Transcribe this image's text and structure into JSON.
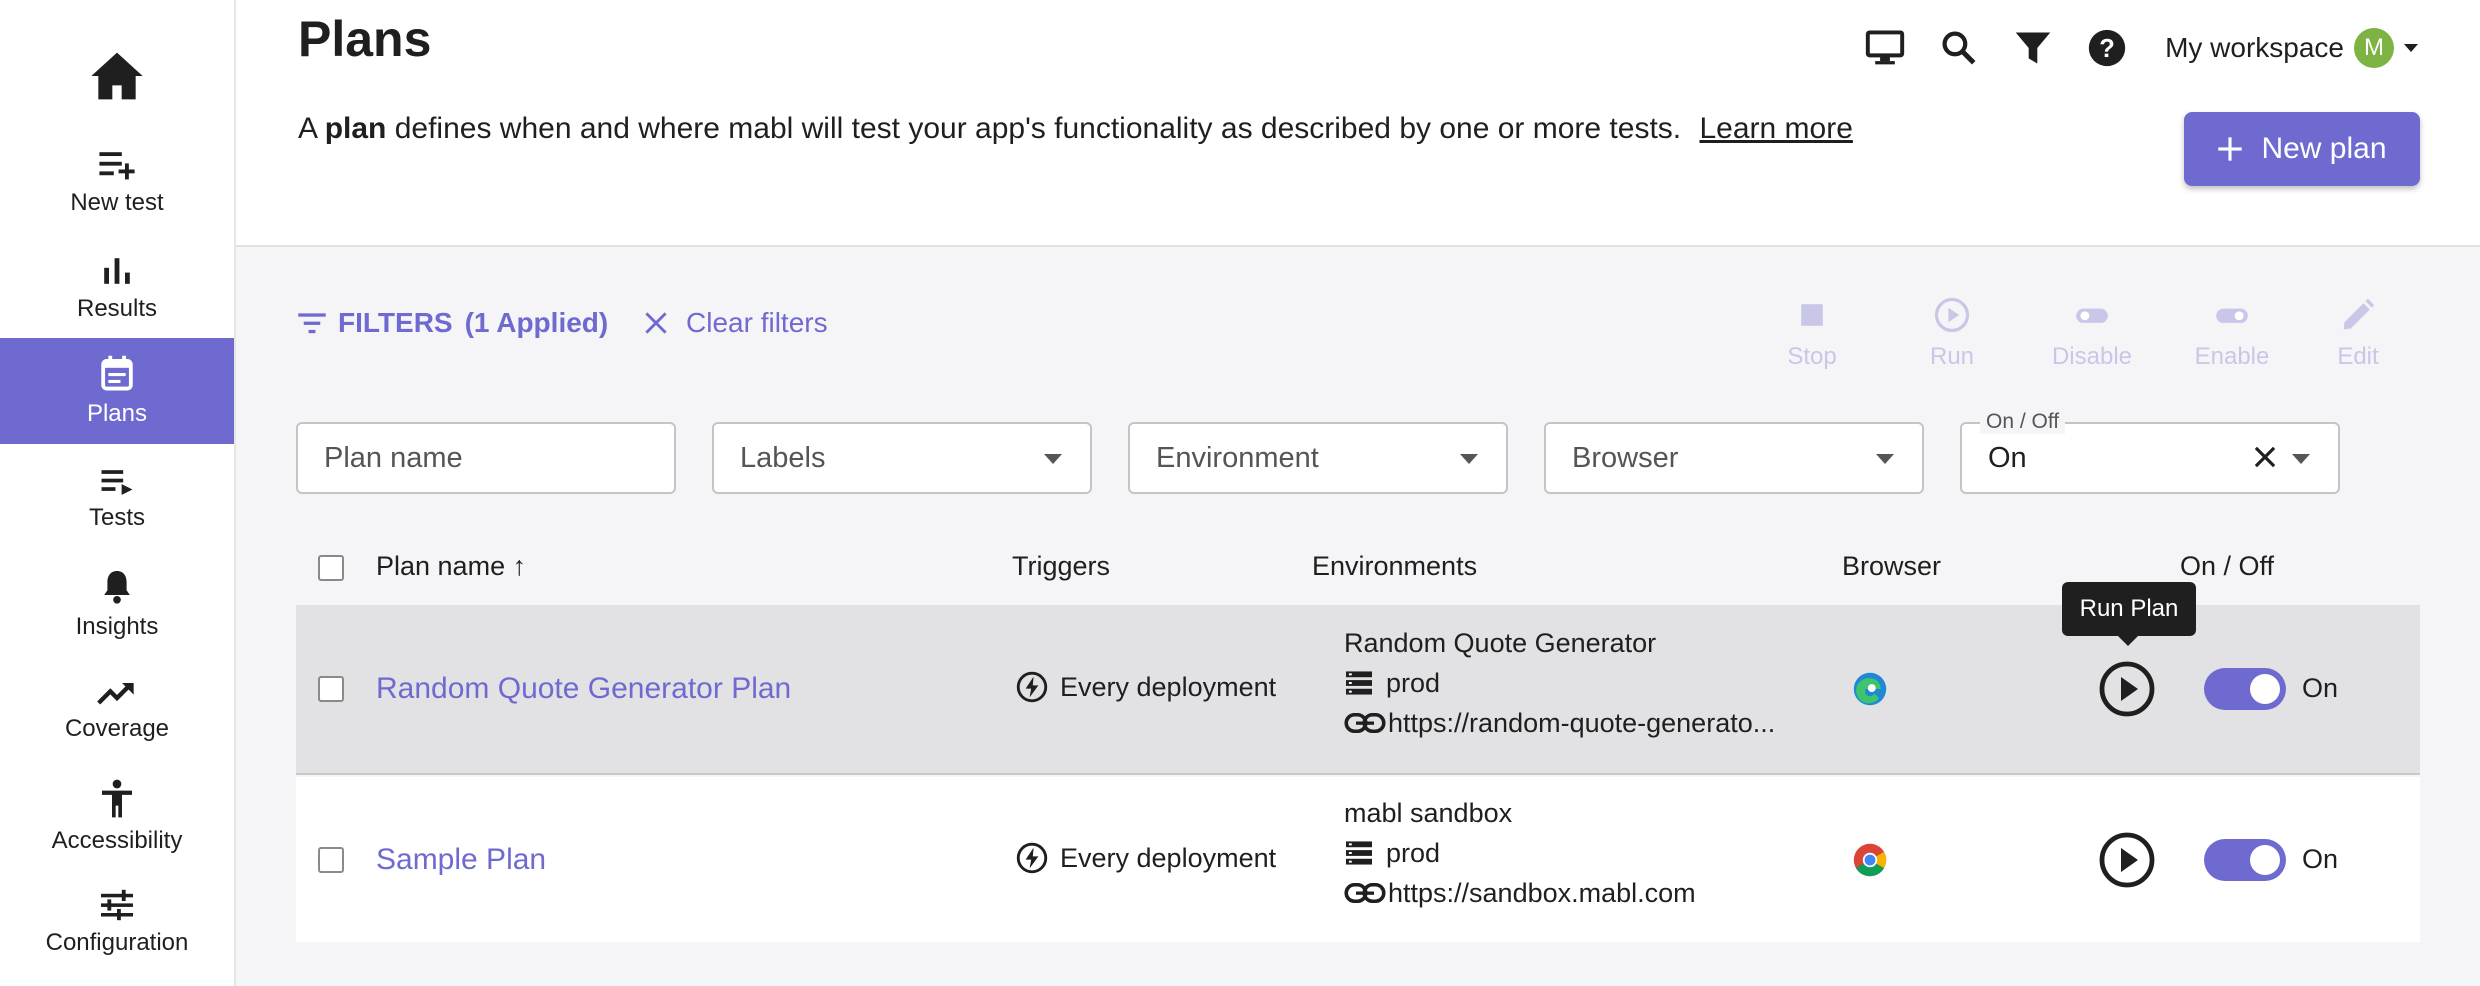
{
  "sidebar": {
    "home_icon": "home-icon",
    "items": [
      {
        "label": "New test",
        "icon": "playlist-add-icon"
      },
      {
        "label": "Results",
        "icon": "bar-chart-icon"
      },
      {
        "label": "Plans",
        "icon": "calendar-icon",
        "active": true
      },
      {
        "label": "Tests",
        "icon": "list-play-icon"
      },
      {
        "label": "Insights",
        "icon": "bell-icon"
      },
      {
        "label": "Coverage",
        "icon": "trending-up-icon"
      },
      {
        "label": "Accessibility",
        "icon": "accessibility-icon"
      },
      {
        "label": "Configuration",
        "icon": "sliders-icon"
      }
    ]
  },
  "header": {
    "title": "Plans",
    "desc_prefix": "A",
    "desc_bold": "plan",
    "desc_suffix": "defines when and where mabl will test your app's functionality as described by one or more tests.",
    "learn_more": "Learn more",
    "workspace": "My workspace",
    "avatar_initial": "M",
    "new_plan": "New plan"
  },
  "toolbar": {
    "filters_label": "FILTERS",
    "filters_count": "(1 Applied)",
    "clear_filters": "Clear filters",
    "actions": [
      "Stop",
      "Run",
      "Disable",
      "Enable",
      "Edit"
    ]
  },
  "filters": {
    "plan_name_placeholder": "Plan name",
    "labels_placeholder": "Labels",
    "environment_placeholder": "Environment",
    "browser_placeholder": "Browser",
    "onoff_label": "On / Off",
    "onoff_value": "On"
  },
  "table": {
    "columns": [
      "Plan name",
      "Triggers",
      "Environments",
      "Browser",
      "On / Off"
    ],
    "sort_indicator": "↑",
    "rows": [
      {
        "name": "Random Quote Generator Plan",
        "trigger": "Every deployment",
        "env_name": "Random Quote Generator",
        "env_db": "prod",
        "env_url": "https://random-quote-generato...",
        "browser": "edge-icon",
        "state": "On"
      },
      {
        "name": "Sample Plan",
        "trigger": "Every deployment",
        "env_name": "mabl sandbox",
        "env_db": "prod",
        "env_url": "https://sandbox.mabl.com",
        "browser": "chrome-icon",
        "state": "On"
      }
    ]
  },
  "tooltip": "Run Plan",
  "colors": {
    "accent": "#6f6ad0",
    "disabled": "#c9c7e8"
  }
}
